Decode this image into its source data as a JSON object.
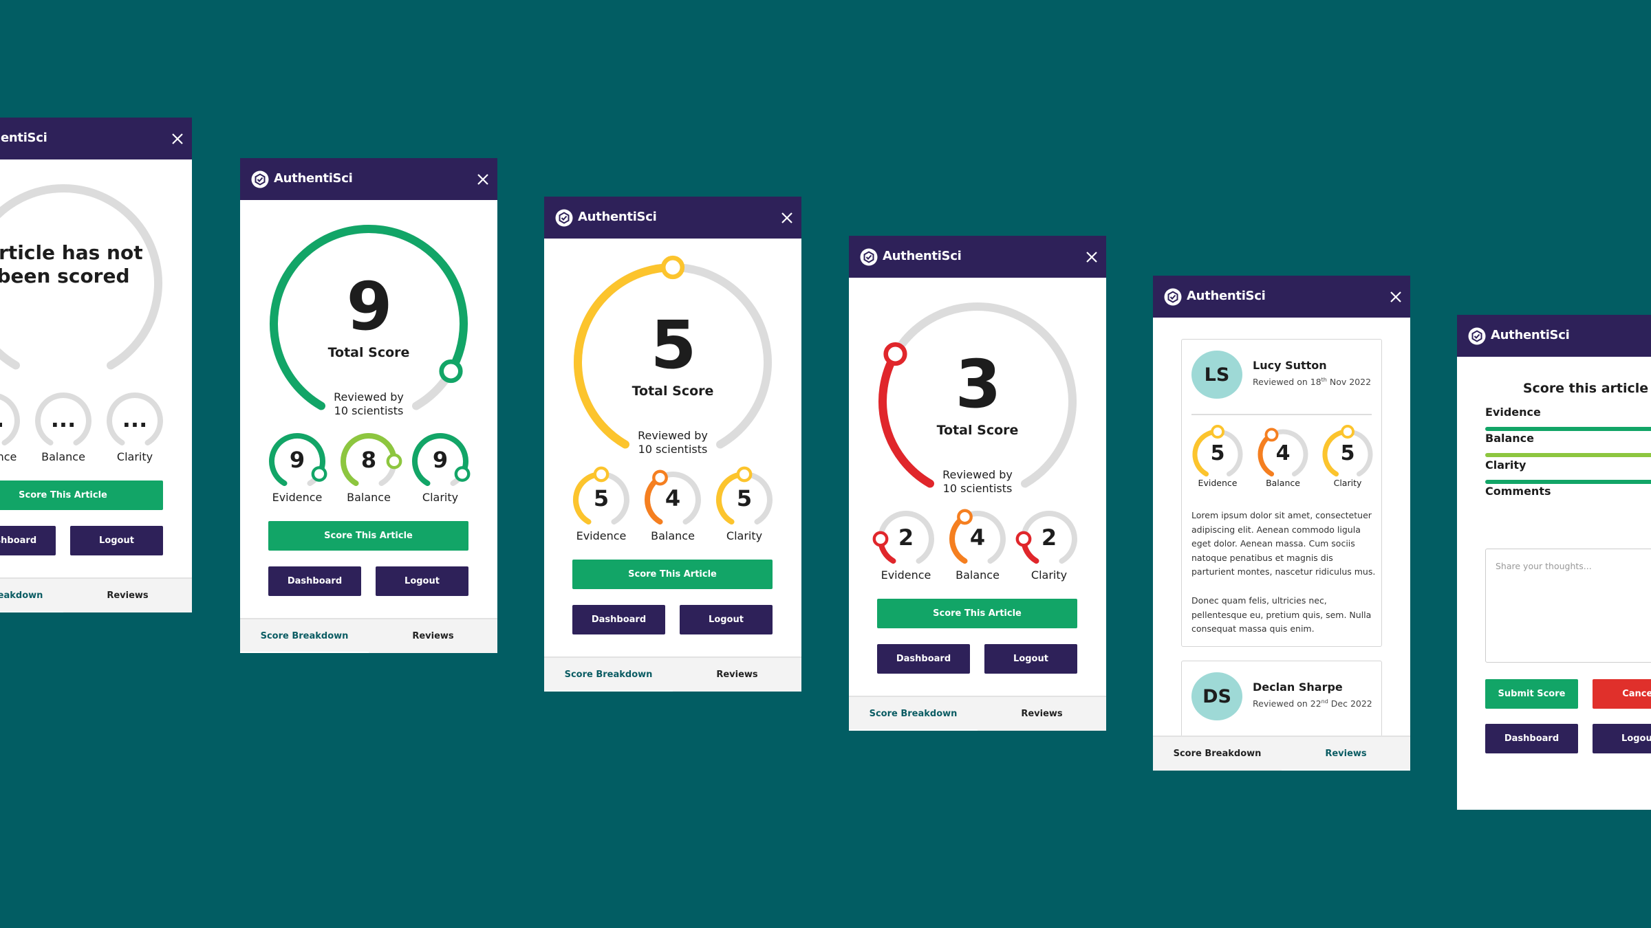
{
  "app": {
    "name": "AuthentiSci",
    "logo_icon": "hexagon-check-icon",
    "close_icon": "close-icon"
  },
  "colors": {
    "background": "#025d63",
    "header": "#2e2159",
    "primary_green": "#12a567",
    "score_9": "#12a567",
    "score_8": "#8dc63f",
    "score_5": "#fcc42d",
    "score_4": "#f57f20",
    "score_low": "#e0262b",
    "unscored": "#dcdcdc",
    "cancel_red": "#e0302b",
    "avatar": "#9ed9d6"
  },
  "panels": [
    {
      "kind": "score",
      "total": null,
      "total_text": [
        "Article has not",
        "been scored"
      ],
      "criteria": [
        {
          "label": "Evidence",
          "value": "..."
        },
        {
          "label": "Balance",
          "value": "..."
        },
        {
          "label": "Clarity",
          "value": "..."
        }
      ],
      "score_button": "Score This Article",
      "dashboard": "Dashboard",
      "logout": "Logout",
      "tabs": [
        "Score Breakdown",
        "Reviews"
      ],
      "active_tab": 0
    },
    {
      "kind": "score",
      "total": 9,
      "total_label": "Total Score",
      "reviewed": [
        "Reviewed by",
        "10 scientists"
      ],
      "criteria": [
        {
          "label": "Evidence",
          "value": 9
        },
        {
          "label": "Balance",
          "value": 8
        },
        {
          "label": "Clarity",
          "value": 9
        }
      ],
      "score_button": "Score This Article",
      "dashboard": "Dashboard",
      "logout": "Logout",
      "tabs": [
        "Score Breakdown",
        "Reviews"
      ],
      "active_tab": 0
    },
    {
      "kind": "score",
      "total": 5,
      "total_label": "Total Score",
      "reviewed": [
        "Reviewed by",
        "10 scientists"
      ],
      "criteria": [
        {
          "label": "Evidence",
          "value": 5
        },
        {
          "label": "Balance",
          "value": 4
        },
        {
          "label": "Clarity",
          "value": 5
        }
      ],
      "score_button": "Score This Article",
      "dashboard": "Dashboard",
      "logout": "Logout",
      "tabs": [
        "Score Breakdown",
        "Reviews"
      ],
      "active_tab": 0
    },
    {
      "kind": "score",
      "total": 3,
      "total_label": "Total Score",
      "reviewed": [
        "Reviewed by",
        "10 scientists"
      ],
      "criteria": [
        {
          "label": "Evidence",
          "value": 2
        },
        {
          "label": "Balance",
          "value": 4
        },
        {
          "label": "Clarity",
          "value": 2
        }
      ],
      "score_button": "Score This Article",
      "dashboard": "Dashboard",
      "logout": "Logout",
      "tabs": [
        "Score Breakdown",
        "Reviews"
      ],
      "active_tab": 0
    },
    {
      "kind": "reviews",
      "reviews": [
        {
          "initials": "LS",
          "name": "Lucy Sutton",
          "date_prefix": "Reviewed on 18",
          "date_sup": "th",
          "date_suffix": " Nov 2022",
          "criteria": [
            {
              "label": "Evidence",
              "value": 5
            },
            {
              "label": "Balance",
              "value": 4
            },
            {
              "label": "Clarity",
              "value": 5
            }
          ],
          "paragraphs": [
            "Lorem ipsum dolor sit amet, consectetuer adipiscing elit. Aenean commodo ligula eget dolor. Aenean massa. Cum sociis natoque penatibus et magnis dis parturient montes, nascetur ridiculus mus.",
            "Donec quam felis, ultricies nec, pellentesque eu, pretium quis, sem. Nulla consequat massa quis enim."
          ]
        },
        {
          "initials": "DS",
          "name": "Declan Sharpe",
          "date_prefix": "Reviewed on 22",
          "date_sup": "nd",
          "date_suffix": " Dec 2022"
        }
      ],
      "tabs": [
        "Score Breakdown",
        "Reviews"
      ],
      "active_tab": 1
    },
    {
      "kind": "form",
      "title": "Score this article",
      "sliders": [
        {
          "label": "Evidence",
          "level": 1.0
        },
        {
          "label": "Balance",
          "level": 0.8
        },
        {
          "label": "Clarity",
          "level": 1.0
        }
      ],
      "comments_label": "Comments",
      "placeholder": "Share your thoughts...",
      "submit": "Submit Score",
      "cancel": "Cancel",
      "dashboard": "Dashboard",
      "logout": "Logout"
    }
  ]
}
